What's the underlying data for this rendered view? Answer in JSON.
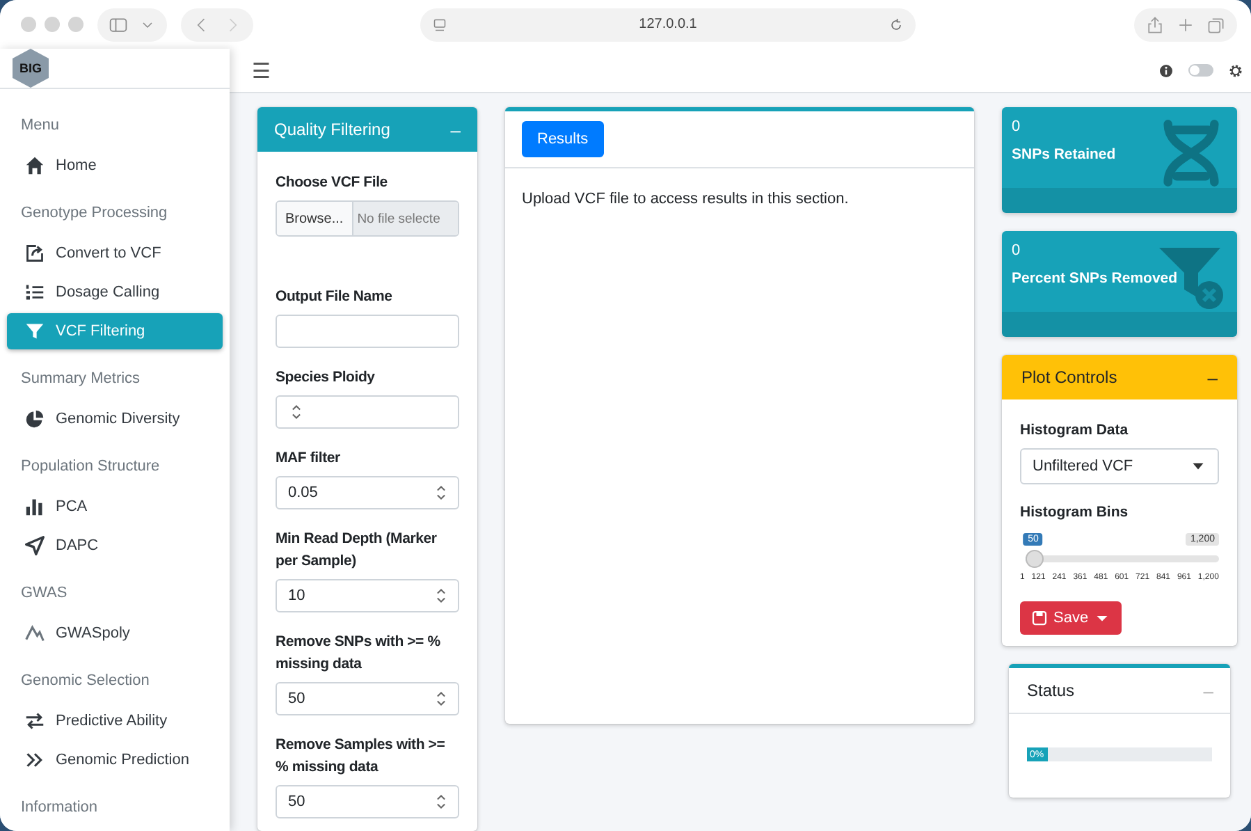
{
  "browser": {
    "url": "127.0.0.1"
  },
  "sidebar": {
    "logo": "BIG",
    "sections": [
      {
        "heading": "Menu",
        "items": [
          {
            "label": "Home",
            "kind": "home",
            "selected": false
          }
        ]
      },
      {
        "heading": "Genotype Processing",
        "items": [
          {
            "label": "Convert to VCF",
            "kind": "export",
            "selected": false
          },
          {
            "label": "Dosage Calling",
            "kind": "list",
            "selected": false
          },
          {
            "label": "VCF Filtering",
            "kind": "filter",
            "selected": true
          }
        ]
      },
      {
        "heading": "Summary Metrics",
        "items": [
          {
            "label": "Genomic Diversity",
            "kind": "pie",
            "selected": false
          }
        ]
      },
      {
        "heading": "Population Structure",
        "items": [
          {
            "label": "PCA",
            "kind": "bars",
            "selected": false
          },
          {
            "label": "DAPC",
            "kind": "send",
            "selected": false
          }
        ]
      },
      {
        "heading": "GWAS",
        "items": [
          {
            "label": "GWASpoly",
            "kind": "line",
            "selected": false
          }
        ]
      },
      {
        "heading": "Genomic Selection",
        "items": [
          {
            "label": "Predictive Ability",
            "kind": "exchange",
            "selected": false
          },
          {
            "label": "Genomic Prediction",
            "kind": "angles",
            "selected": false
          }
        ]
      },
      {
        "heading": "Information"
      }
    ]
  },
  "header": {
    "menu_button": "☰",
    "dark_mode": false
  },
  "quality_filtering": {
    "title": "Quality Filtering",
    "collapse": "–",
    "fields": [
      {
        "kind": "file",
        "label": "Choose VCF File",
        "button": "Browse...",
        "placeholder": "No file selecte"
      },
      {
        "kind": "text",
        "label": "Output File Name"
      },
      {
        "kind": "number",
        "label": "Species Ploidy"
      },
      {
        "kind": "number",
        "label": "MAF filter",
        "value": "0.05"
      },
      {
        "kind": "number",
        "label": "Min Read Depth (Marker per Sample)",
        "value": "10"
      },
      {
        "kind": "number",
        "label": "Remove SNPs with >= % missing data",
        "value": "50"
      },
      {
        "kind": "number",
        "label": "Remove Samples with >= % missing data",
        "value": "50"
      }
    ]
  },
  "results": {
    "tabs": [
      {
        "label": "Results",
        "selected": true
      }
    ],
    "message": "Upload VCF file to access results in this section."
  },
  "value_boxes": [
    {
      "value": "0",
      "label": "SNPs Retained",
      "kind": "dna"
    },
    {
      "value": "0",
      "label": "Percent SNPs Removed",
      "kind": "funnel"
    }
  ],
  "plot_controls": {
    "title": "Plot Controls",
    "collapse": "–",
    "data_label": "Histogram Data",
    "data_value": "Unfiltered VCF",
    "bins_label": "Histogram Bins",
    "slider": {
      "value": "50",
      "max": "1,200",
      "level": 0.04,
      "ticks": [
        "1",
        "121",
        "241",
        "361",
        "481",
        "601",
        "721",
        "841",
        "961",
        "1,200"
      ]
    },
    "save": "Save"
  },
  "status": {
    "title": "Status",
    "collapse": "–",
    "level": 0,
    "reading": "0%"
  }
}
